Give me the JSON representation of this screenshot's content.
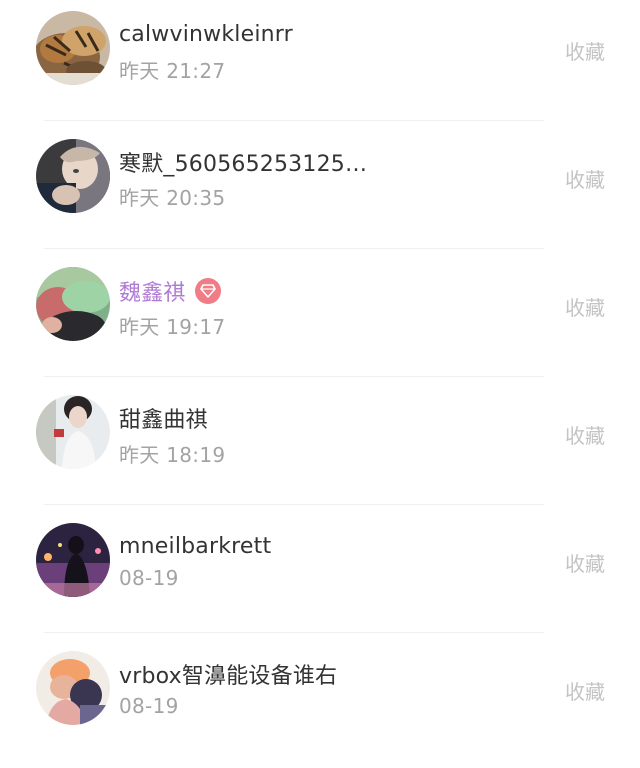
{
  "favorite_list": {
    "items": [
      {
        "name": "calwvinwkleinrr",
        "time": "昨天 21:27",
        "action": "收藏",
        "avatar": "tiger-photo-avatar"
      },
      {
        "name": "寒默_560565253125…",
        "time": "昨天 20:35",
        "action": "收藏",
        "avatar": "person-portrait-avatar"
      },
      {
        "name": "魏鑫祺",
        "time": "昨天 19:17",
        "action": "收藏",
        "avatar": "people-hug-avatar",
        "vip": true,
        "badge_icon": "diamond-icon"
      },
      {
        "name": "甜鑫曲祺",
        "time": "昨天 18:19",
        "action": "收藏",
        "avatar": "girl-portrait-avatar"
      },
      {
        "name": "mneilbarkrett",
        "time": "08-19",
        "action": "收藏",
        "avatar": "night-silhouette-avatar"
      },
      {
        "name": "vrbox智濞能设备谁右",
        "time": "08-19",
        "action": "收藏",
        "avatar": "couple-avatar"
      }
    ]
  },
  "colors": {
    "name_text": "#333333",
    "vip_name_text": "#b07ad6",
    "time_text": "#a3a3a3",
    "action_text": "#c4c4c4",
    "badge_bg": "#f07d86",
    "divider": "#f0f0f0"
  }
}
